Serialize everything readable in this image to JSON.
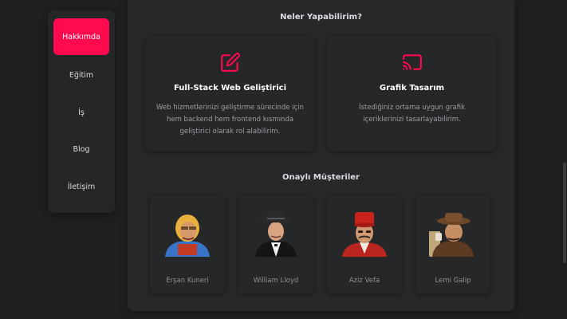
{
  "sidebar": {
    "items": [
      {
        "label": "Hakkımda",
        "active": true
      },
      {
        "label": "Eğitim",
        "active": false
      },
      {
        "label": "İş",
        "active": false
      },
      {
        "label": "Blog",
        "active": false
      },
      {
        "label": "İletişim",
        "active": false
      }
    ]
  },
  "services": {
    "title": "Neler Yapabilirim?",
    "accent_color": "#ff0a4e",
    "cards": [
      {
        "icon": "edit-icon",
        "title": "Full-Stack Web Geliştirici",
        "description": "Web hizmetlerinizi geliştirme sürecinde için hem backend hem frontend kısmında geliştirici olarak rol alabilirim."
      },
      {
        "icon": "cast-icon",
        "title": "Grafik Tasarım",
        "description": "İstediğiniz ortama uygun grafik içeriklerinizi tasarlayabilirim."
      }
    ]
  },
  "clients": {
    "title": "Onaylı Müşteriler",
    "items": [
      {
        "name": "Erşan Kuneri"
      },
      {
        "name": "William Lloyd"
      },
      {
        "name": "Aziz Vefa"
      },
      {
        "name": "Lemi Galip"
      }
    ]
  }
}
